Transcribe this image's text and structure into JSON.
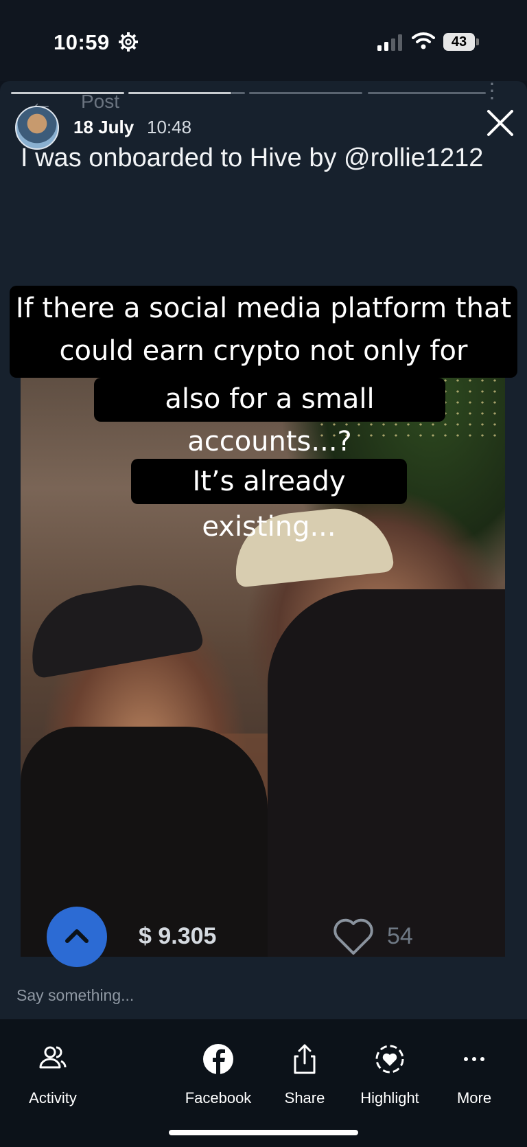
{
  "status_bar": {
    "time": "10:59",
    "battery": "43"
  },
  "story": {
    "post_label": "Post",
    "date": "18 July",
    "time": "10:48",
    "caption": "I was onboarded to Hive by @rollie1212",
    "overlay_text_1": "If there a social media platform that could earn crypto not only for influencers, but",
    "overlay_text_2": "also for a small accounts...?",
    "overlay_text_3": "It’s already existing...",
    "payout": "$ 9.305",
    "likes": "54",
    "comment_placeholder": "Say something..."
  },
  "tabs": [
    {
      "label": "Activity",
      "icon": "people-icon"
    },
    {
      "label": "Facebook",
      "icon": "facebook-icon"
    },
    {
      "label": "Share",
      "icon": "share-icon"
    },
    {
      "label": "Highlight",
      "icon": "highlight-heart-icon"
    },
    {
      "label": "More",
      "icon": "more-dots-icon"
    }
  ],
  "colors": {
    "vote_button": "#2c6bd4",
    "background": "#17212d"
  }
}
